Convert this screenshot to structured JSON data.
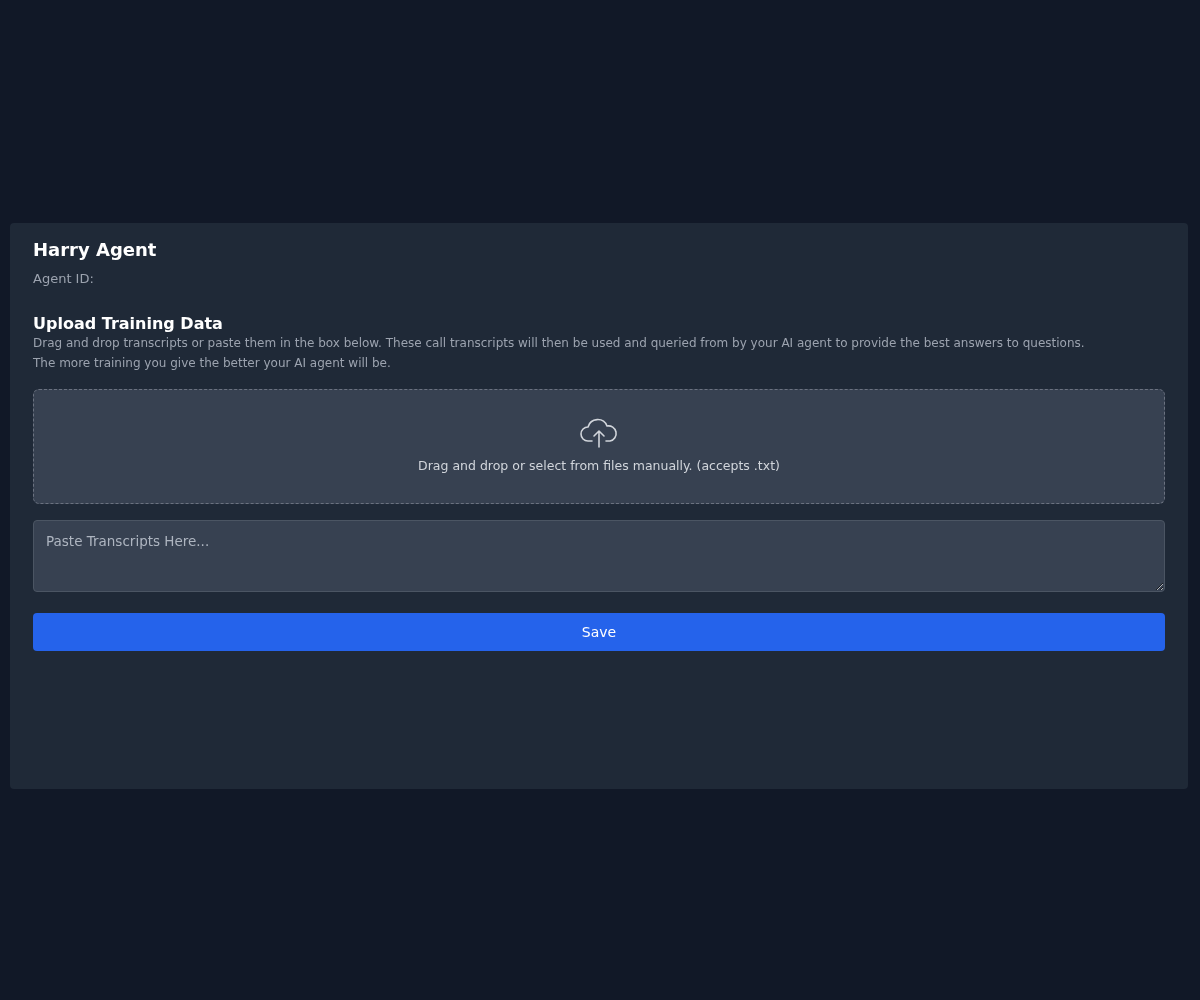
{
  "agent": {
    "name": "Harry Agent",
    "id_label": "Agent ID:"
  },
  "upload": {
    "title": "Upload Training Data",
    "description_lines": [
      "Drag and drop transcripts or paste them in the box below. These call transcripts will then be used and queried from by your AI agent to provide the best answers to questions.",
      "The more training you give the better your AI agent will be."
    ],
    "dropzone_text": "Drag and drop or select from files manually. (accepts .txt)",
    "textarea": {
      "placeholder": "Paste Transcripts Here..."
    },
    "save_button": "Save"
  }
}
